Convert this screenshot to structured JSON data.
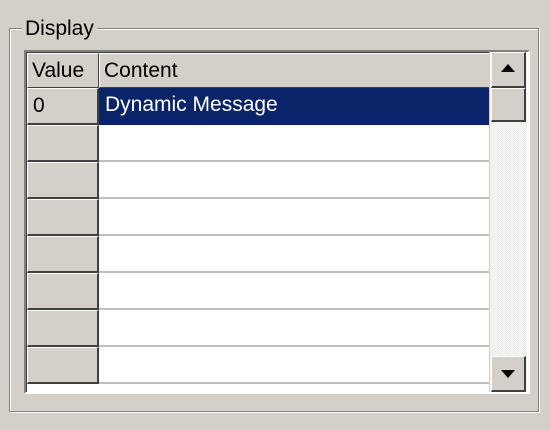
{
  "group": {
    "title": "Display"
  },
  "grid": {
    "columns": [
      "Value",
      "Content"
    ],
    "rows": [
      {
        "value": "0",
        "content": "Dynamic Message",
        "selected": true
      },
      {
        "value": "",
        "content": ""
      },
      {
        "value": "",
        "content": ""
      },
      {
        "value": "",
        "content": ""
      },
      {
        "value": "",
        "content": ""
      },
      {
        "value": "",
        "content": ""
      },
      {
        "value": "",
        "content": ""
      },
      {
        "value": "",
        "content": ""
      }
    ]
  },
  "colors": {
    "selection": "#0a246a",
    "face": "#d4d0c8"
  },
  "icons": {
    "scroll_up": "up-arrow-icon",
    "scroll_down": "down-arrow-icon"
  }
}
